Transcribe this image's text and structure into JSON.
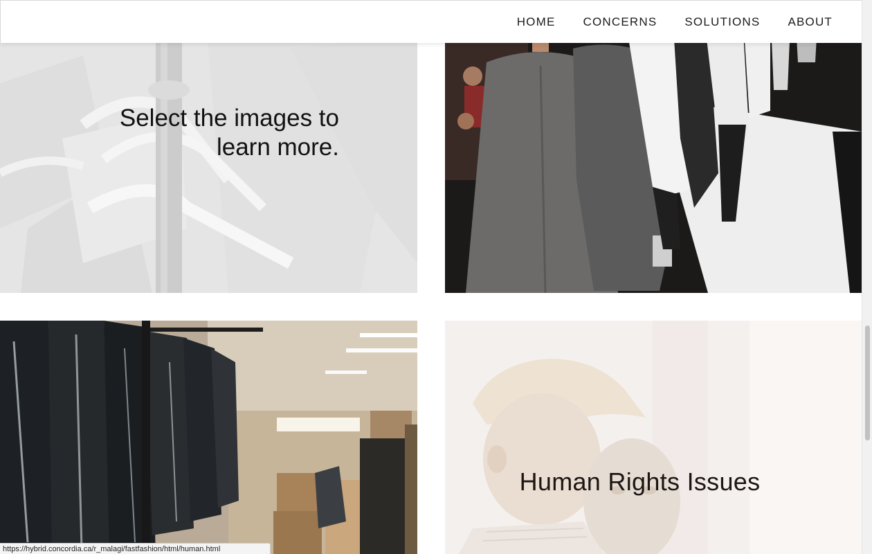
{
  "nav": {
    "items": [
      {
        "label": "HOME"
      },
      {
        "label": "CONCERNS"
      },
      {
        "label": "SOLUTIONS"
      },
      {
        "label": "ABOUT"
      }
    ]
  },
  "tiles": {
    "intro": {
      "line1": "Select the images to",
      "line2": "learn more."
    },
    "human_rights": {
      "caption": "Human Rights Issues"
    }
  },
  "status_bar": {
    "url": "https://hybrid.concordia.ca/r_malagi/fastfashion/html/human.html"
  },
  "colors": {
    "text_dark": "#111111",
    "nav_text": "#1a1a1a",
    "background": "#ffffff"
  },
  "icons": {
    "scrollbar": "vertical-scrollbar"
  }
}
